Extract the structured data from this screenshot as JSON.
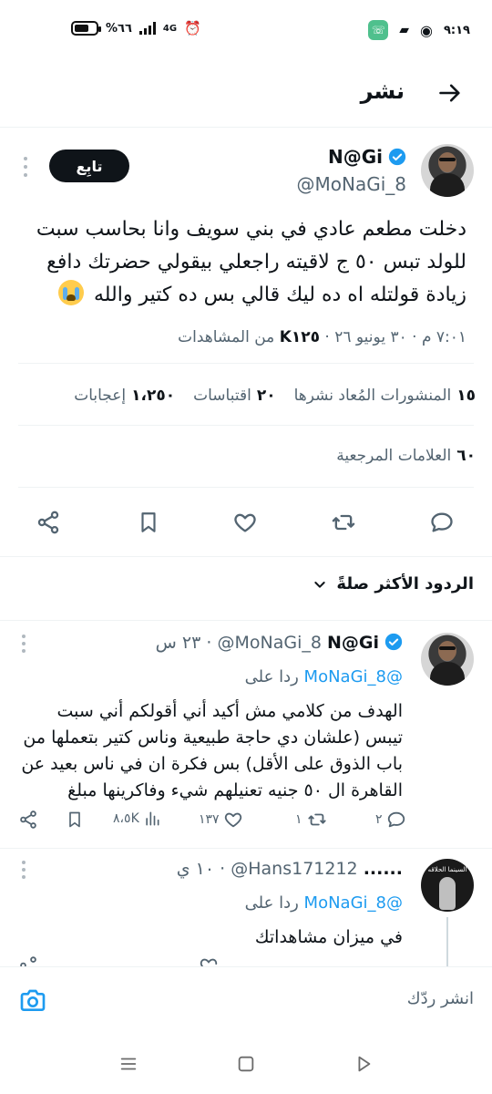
{
  "status_bar": {
    "time": "٩:١٩",
    "battery_text": "%٦٦",
    "battery_level": 0.66,
    "network": "4G"
  },
  "header": {
    "title": "نشر"
  },
  "tweet": {
    "author_name": "N@Gi",
    "author_handle": "@MoNaGi_8",
    "follow_label": "تابِع",
    "text": "دخلت مطعم عادي في بني سويف وانا بحاسب سبت للولد تبس ٥٠ ج لاقيته راجعلي بيقولي حضرتك دافع زيادة قولتله اه ده ليك قالي بس ده كتير والله",
    "time": "٧:٠١ م",
    "date": "٣٠ يونيو ٢٦",
    "views_count": "K١٢٥",
    "views_label": "من المشاهدات",
    "reposts_count": "١٥",
    "reposts_label": "المنشورات المُعاد نشرها",
    "quotes_count": "٢٠",
    "quotes_label": "اقتباسات",
    "likes_count": "١،٢٥٠",
    "likes_label": "إعجابات",
    "bookmarks_count": "٦٠",
    "bookmarks_label": "العلامات المرجعية"
  },
  "sort": {
    "label": "الردود الأكثر صلةً"
  },
  "replies": [
    {
      "author_name": "N@Gi",
      "author_handle": "@MoNaGi_8",
      "age": "٢٣ س",
      "replying_prefix": "ردا على",
      "replying_handle": "@MoNaGi_8",
      "text": "الهدف من كلامي مش أكيد أني أقولكم أني سبت تيبس (علشان دي حاجة طبيعية وناس كتير بتعملها من باب الذوق على الأقل) بس فكرة ان في ناس بعيد عن القاهرة ال ٥٠ جنيه تعنيلهم شيء وفاكرينها مبلغ",
      "replies_count": "٢",
      "reposts_count": "١",
      "likes_count": "١٣٧",
      "views_count": "٨،٥K"
    },
    {
      "author_name": "......",
      "author_handle": "@Hans171212",
      "age": "١٠ ي",
      "replying_prefix": "ردا على",
      "replying_handle": "@MoNaGi_8",
      "text": "في ميزان مشاهداتك",
      "avatar_text": "السينما الحلاقه"
    }
  ],
  "compose": {
    "placeholder": "انشر ردّك"
  },
  "colors": {
    "accent": "#1d9bf0",
    "text": "#0f1419",
    "muted": "#536471"
  }
}
